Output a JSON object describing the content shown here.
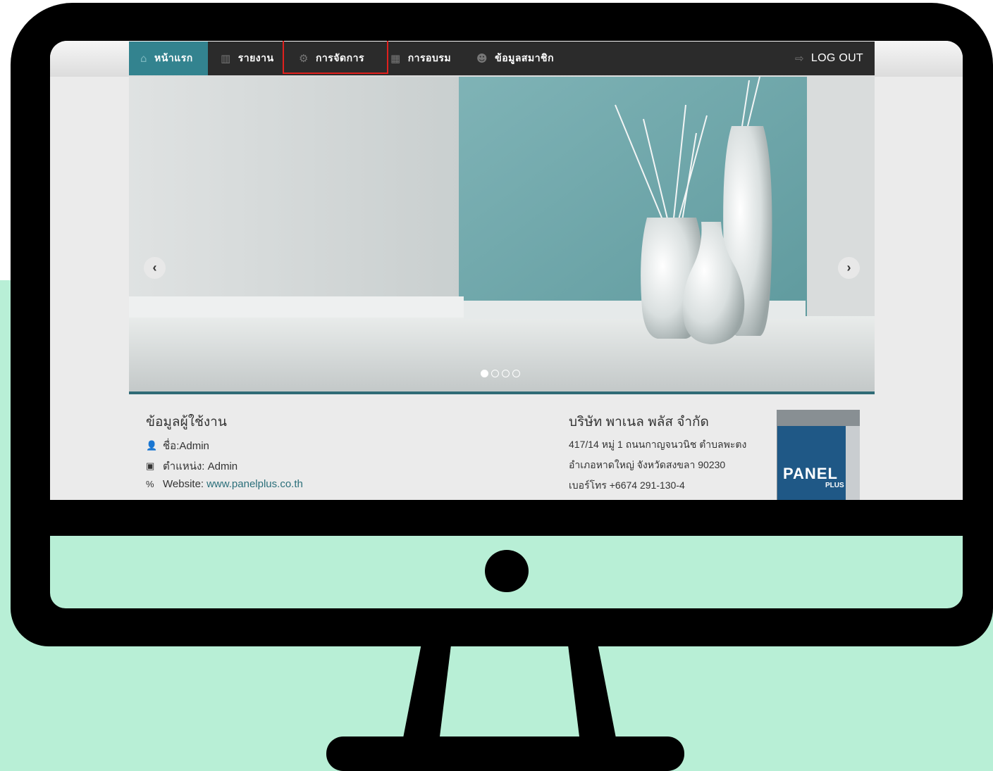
{
  "nav": {
    "home": "หน้าแรก",
    "reports": "รายงาน",
    "manage": "การจัดการ",
    "training": "การอบรม",
    "members": "ข้อมูลสมาชิก",
    "logout": "LOG OUT"
  },
  "slider": {
    "prev": "‹",
    "next": "›",
    "slide_count": 4,
    "active_slide": 1
  },
  "user_info": {
    "title": "ข้อมูลผู้ใช้งาน",
    "name": "ชื่อ:Admin",
    "position": "ตำแหน่ง: Admin",
    "website_label": "Website:",
    "website_link": "www.panelplus.co.th"
  },
  "company": {
    "title": "บริษัท พาเนล พลัส จำกัด",
    "address1": "417/14 หมู่ 1 ถนนกาญจนวนิช ตำบลพะตง",
    "address2": "อำเภอหาดใหญ่ จังหวัดสงขลา 90230",
    "phone": "เบอร์โทร +6674 291-130-4"
  },
  "logo": {
    "text": "PANEL",
    "sub": "PLUS"
  },
  "colors": {
    "mint": "#b8efd6",
    "teal": "#33838f",
    "nav": "#2b2b2b",
    "highlight": "#e0201d"
  }
}
